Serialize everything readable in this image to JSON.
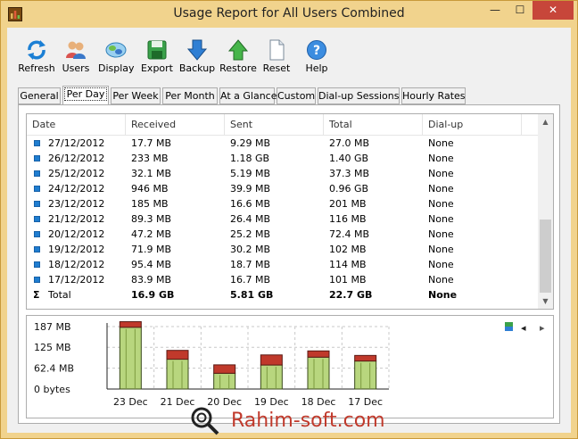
{
  "window": {
    "title": "Usage Report for All Users Combined",
    "controls": {
      "minimize": "—",
      "maximize": "☐",
      "close": "✕"
    }
  },
  "toolbar": {
    "buttons": [
      {
        "label": "Refresh",
        "icon": "refresh-icon"
      },
      {
        "label": "Users",
        "icon": "users-icon"
      },
      {
        "label": "Display",
        "icon": "display-icon"
      },
      {
        "label": "Export",
        "icon": "export-icon"
      },
      {
        "label": "Backup",
        "icon": "backup-icon"
      },
      {
        "label": "Restore",
        "icon": "restore-icon"
      },
      {
        "label": "Reset",
        "icon": "reset-icon"
      },
      {
        "label": "Help",
        "icon": "help-icon"
      }
    ]
  },
  "tabs": [
    {
      "label": "General",
      "active": false
    },
    {
      "label": "Per Day",
      "active": true
    },
    {
      "label": "Per Week",
      "active": false
    },
    {
      "label": "Per Month",
      "active": false
    },
    {
      "label": "At a Glance",
      "active": false
    },
    {
      "label": "Custom",
      "active": false
    },
    {
      "label": "Dial-up Sessions",
      "active": false
    },
    {
      "label": "Hourly Rates",
      "active": false
    }
  ],
  "table": {
    "columns": [
      "Date",
      "Received",
      "Sent",
      "Total",
      "Dial-up"
    ],
    "rows": [
      [
        "27/12/2012",
        "17.7 MB",
        "9.29 MB",
        "27.0 MB",
        "None"
      ],
      [
        "26/12/2012",
        "233 MB",
        "1.18 GB",
        "1.40 GB",
        "None"
      ],
      [
        "25/12/2012",
        "32.1 MB",
        "5.19 MB",
        "37.3 MB",
        "None"
      ],
      [
        "24/12/2012",
        "946 MB",
        "39.9 MB",
        "0.96 GB",
        "None"
      ],
      [
        "23/12/2012",
        "185 MB",
        "16.6 MB",
        "201 MB",
        "None"
      ],
      [
        "21/12/2012",
        "89.3 MB",
        "26.4 MB",
        "116 MB",
        "None"
      ],
      [
        "20/12/2012",
        "47.2 MB",
        "25.2 MB",
        "72.4 MB",
        "None"
      ],
      [
        "19/12/2012",
        "71.9 MB",
        "30.2 MB",
        "102 MB",
        "None"
      ],
      [
        "18/12/2012",
        "95.4 MB",
        "18.7 MB",
        "114 MB",
        "None"
      ],
      [
        "17/12/2012",
        "83.9 MB",
        "16.7 MB",
        "101 MB",
        "None"
      ]
    ],
    "total": {
      "symbol": "Σ",
      "label": "Total",
      "received": "16.9 GB",
      "sent": "5.81 GB",
      "total": "22.7 GB",
      "dialup": "None"
    }
  },
  "chart_data": {
    "type": "bar",
    "stacked": true,
    "categories": [
      "23 Dec",
      "21 Dec",
      "20 Dec",
      "19 Dec",
      "18 Dec",
      "17 Dec"
    ],
    "series": [
      {
        "values": [
          185,
          89.3,
          47.2,
          71.9,
          95.4,
          83.9
        ],
        "color": "#b8d67e"
      },
      {
        "values": [
          16.6,
          26.4,
          25.2,
          30.2,
          18.7,
          16.7
        ],
        "color": "#c0392b"
      }
    ],
    "y_ticks": [
      {
        "value": 187,
        "label": "187 MB"
      },
      {
        "value": 125,
        "label": "125 MB"
      },
      {
        "value": 62.4,
        "label": "62.4 MB"
      },
      {
        "value": 0,
        "label": "0 bytes"
      }
    ],
    "ylim": [
      0,
      187
    ],
    "grid": true,
    "controls": {
      "prev": "◂",
      "next": "▸",
      "legend_icon": "legend-icon"
    }
  },
  "watermark": {
    "text": "Rahim-soft.com"
  },
  "colors": {
    "titlebar": "#f1d38d",
    "close": "#c7463a",
    "accent": "#1f7dd0"
  }
}
